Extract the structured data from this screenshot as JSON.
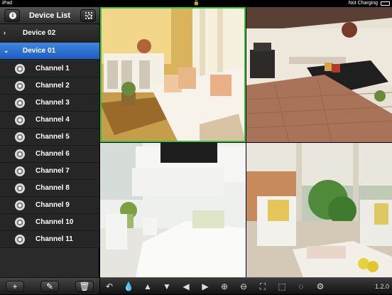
{
  "status_bar": {
    "device": "iPad",
    "time": "",
    "network": "Not Charging"
  },
  "sidebar": {
    "title": "Device List",
    "devices": [
      {
        "label": "Device 02",
        "expanded": false
      },
      {
        "label": "Device 01",
        "expanded": true,
        "selected": true
      }
    ],
    "channels": [
      "Channel 1",
      "Channel 2",
      "Channel 3",
      "Channel 4",
      "Channel 5",
      "Channel 6",
      "Channel 7",
      "Channel 8",
      "Channel 9",
      "Channel 10",
      "Channel 11"
    ],
    "footer": {
      "add": "+",
      "edit": "✎",
      "delete": "🗑"
    }
  },
  "views": [
    {
      "name": "living-room-view",
      "selected": true
    },
    {
      "name": "fireplace-view",
      "selected": false
    },
    {
      "name": "white-lounge-view",
      "selected": false
    },
    {
      "name": "conservatory-view",
      "selected": false
    }
  ],
  "toolbar": {
    "version": "1.2.0",
    "icons": [
      "back-icon",
      "drop-icon",
      "pan-up-icon",
      "pan-down-icon",
      "pan-left-icon",
      "pan-right-icon",
      "zoom-in-icon",
      "zoom-out-icon",
      "fit-icon",
      "fullscreen-icon",
      "record-icon",
      "settings-icon"
    ]
  }
}
